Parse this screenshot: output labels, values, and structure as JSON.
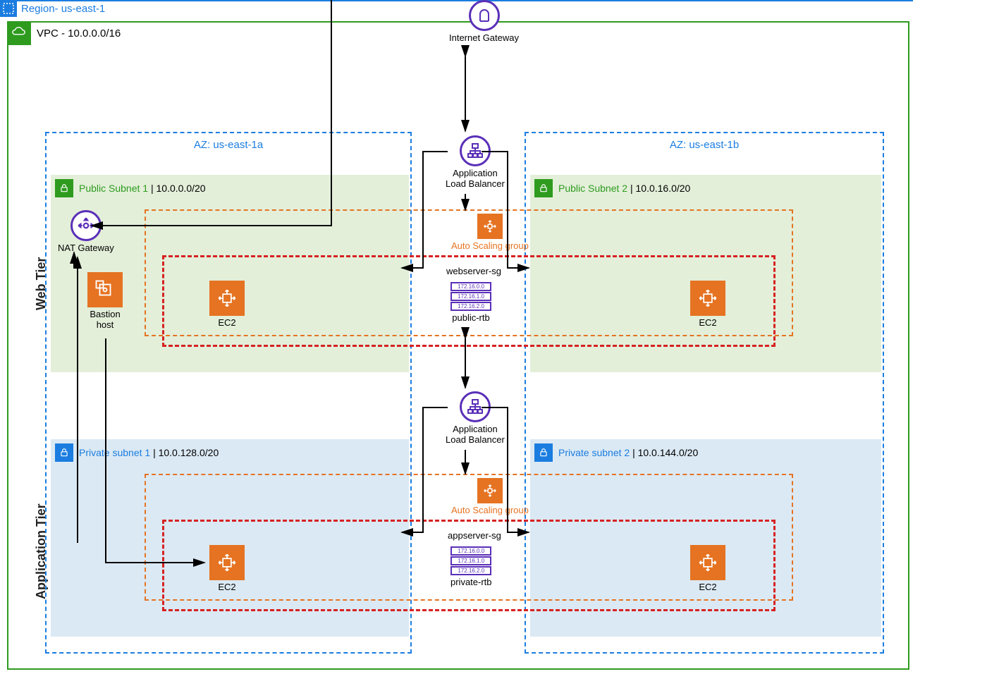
{
  "region": {
    "label": "Region- us-east-1"
  },
  "vpc": {
    "label": "VPC - 10.0.0.0/16"
  },
  "az": {
    "a": "AZ: us-east-1a",
    "b": "AZ: us-east-1b"
  },
  "tiers": {
    "web": "Web Tier",
    "app": "Application Tier"
  },
  "subnets": {
    "pub1": {
      "name": "Public Subnet 1",
      "cidr": "10.0.0.0/20"
    },
    "pub2": {
      "name": "Public Subnet 2",
      "cidr": "10.0.16.0/20"
    },
    "priv1": {
      "name": "Private subnet 1",
      "cidr": "10.0.128.0/20"
    },
    "priv2": {
      "name": "Private subnet 2",
      "cidr": "10.0.144.0/20"
    }
  },
  "nodes": {
    "igw": "Internet Gateway",
    "alb1": "Application\nLoad Balancer",
    "alb2": "Application\nLoad Balancer",
    "asg": "Auto Scaling group",
    "nat": "NAT Gateway",
    "bastion": "Bastion\nhost",
    "ec2": "EC2"
  },
  "sg": {
    "web": "webserver-sg",
    "app": "appserver-sg"
  },
  "rtb": {
    "pub": {
      "label": "public-rtb",
      "rows": [
        "172.16.0.0",
        "172.16.1.0",
        "172.16.2.0"
      ]
    },
    "priv": {
      "label": "private-rtb",
      "rows": [
        "172.16.0.0",
        "172.16.1.0",
        "172.16.2.0"
      ]
    }
  }
}
